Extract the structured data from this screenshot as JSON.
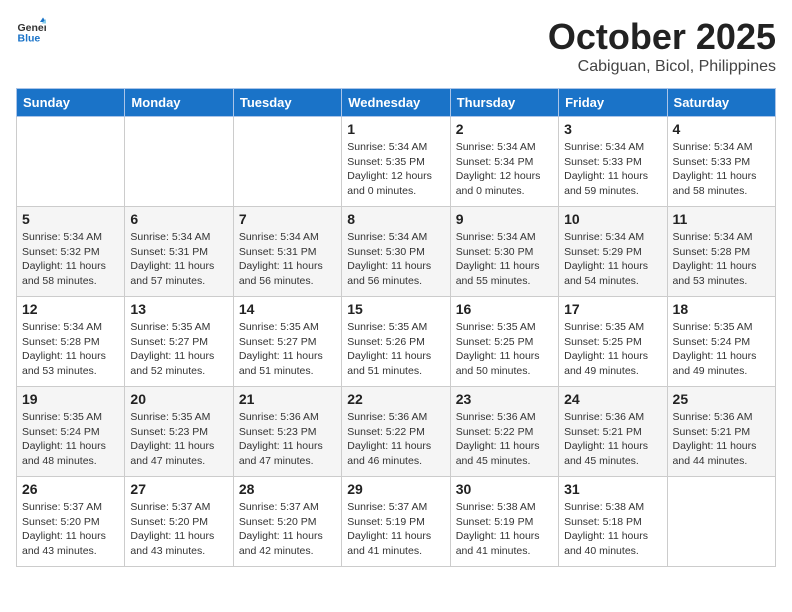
{
  "logo": {
    "line1": "General",
    "line2": "Blue"
  },
  "title": "October 2025",
  "location": "Cabiguan, Bicol, Philippines",
  "days_of_week": [
    "Sunday",
    "Monday",
    "Tuesday",
    "Wednesday",
    "Thursday",
    "Friday",
    "Saturday"
  ],
  "weeks": [
    [
      {
        "day": "",
        "info": ""
      },
      {
        "day": "",
        "info": ""
      },
      {
        "day": "",
        "info": ""
      },
      {
        "day": "1",
        "info": "Sunrise: 5:34 AM\nSunset: 5:35 PM\nDaylight: 12 hours\nand 0 minutes."
      },
      {
        "day": "2",
        "info": "Sunrise: 5:34 AM\nSunset: 5:34 PM\nDaylight: 12 hours\nand 0 minutes."
      },
      {
        "day": "3",
        "info": "Sunrise: 5:34 AM\nSunset: 5:33 PM\nDaylight: 11 hours\nand 59 minutes."
      },
      {
        "day": "4",
        "info": "Sunrise: 5:34 AM\nSunset: 5:33 PM\nDaylight: 11 hours\nand 58 minutes."
      }
    ],
    [
      {
        "day": "5",
        "info": "Sunrise: 5:34 AM\nSunset: 5:32 PM\nDaylight: 11 hours\nand 58 minutes."
      },
      {
        "day": "6",
        "info": "Sunrise: 5:34 AM\nSunset: 5:31 PM\nDaylight: 11 hours\nand 57 minutes."
      },
      {
        "day": "7",
        "info": "Sunrise: 5:34 AM\nSunset: 5:31 PM\nDaylight: 11 hours\nand 56 minutes."
      },
      {
        "day": "8",
        "info": "Sunrise: 5:34 AM\nSunset: 5:30 PM\nDaylight: 11 hours\nand 56 minutes."
      },
      {
        "day": "9",
        "info": "Sunrise: 5:34 AM\nSunset: 5:30 PM\nDaylight: 11 hours\nand 55 minutes."
      },
      {
        "day": "10",
        "info": "Sunrise: 5:34 AM\nSunset: 5:29 PM\nDaylight: 11 hours\nand 54 minutes."
      },
      {
        "day": "11",
        "info": "Sunrise: 5:34 AM\nSunset: 5:28 PM\nDaylight: 11 hours\nand 53 minutes."
      }
    ],
    [
      {
        "day": "12",
        "info": "Sunrise: 5:34 AM\nSunset: 5:28 PM\nDaylight: 11 hours\nand 53 minutes."
      },
      {
        "day": "13",
        "info": "Sunrise: 5:35 AM\nSunset: 5:27 PM\nDaylight: 11 hours\nand 52 minutes."
      },
      {
        "day": "14",
        "info": "Sunrise: 5:35 AM\nSunset: 5:27 PM\nDaylight: 11 hours\nand 51 minutes."
      },
      {
        "day": "15",
        "info": "Sunrise: 5:35 AM\nSunset: 5:26 PM\nDaylight: 11 hours\nand 51 minutes."
      },
      {
        "day": "16",
        "info": "Sunrise: 5:35 AM\nSunset: 5:25 PM\nDaylight: 11 hours\nand 50 minutes."
      },
      {
        "day": "17",
        "info": "Sunrise: 5:35 AM\nSunset: 5:25 PM\nDaylight: 11 hours\nand 49 minutes."
      },
      {
        "day": "18",
        "info": "Sunrise: 5:35 AM\nSunset: 5:24 PM\nDaylight: 11 hours\nand 49 minutes."
      }
    ],
    [
      {
        "day": "19",
        "info": "Sunrise: 5:35 AM\nSunset: 5:24 PM\nDaylight: 11 hours\nand 48 minutes."
      },
      {
        "day": "20",
        "info": "Sunrise: 5:35 AM\nSunset: 5:23 PM\nDaylight: 11 hours\nand 47 minutes."
      },
      {
        "day": "21",
        "info": "Sunrise: 5:36 AM\nSunset: 5:23 PM\nDaylight: 11 hours\nand 47 minutes."
      },
      {
        "day": "22",
        "info": "Sunrise: 5:36 AM\nSunset: 5:22 PM\nDaylight: 11 hours\nand 46 minutes."
      },
      {
        "day": "23",
        "info": "Sunrise: 5:36 AM\nSunset: 5:22 PM\nDaylight: 11 hours\nand 45 minutes."
      },
      {
        "day": "24",
        "info": "Sunrise: 5:36 AM\nSunset: 5:21 PM\nDaylight: 11 hours\nand 45 minutes."
      },
      {
        "day": "25",
        "info": "Sunrise: 5:36 AM\nSunset: 5:21 PM\nDaylight: 11 hours\nand 44 minutes."
      }
    ],
    [
      {
        "day": "26",
        "info": "Sunrise: 5:37 AM\nSunset: 5:20 PM\nDaylight: 11 hours\nand 43 minutes."
      },
      {
        "day": "27",
        "info": "Sunrise: 5:37 AM\nSunset: 5:20 PM\nDaylight: 11 hours\nand 43 minutes."
      },
      {
        "day": "28",
        "info": "Sunrise: 5:37 AM\nSunset: 5:20 PM\nDaylight: 11 hours\nand 42 minutes."
      },
      {
        "day": "29",
        "info": "Sunrise: 5:37 AM\nSunset: 5:19 PM\nDaylight: 11 hours\nand 41 minutes."
      },
      {
        "day": "30",
        "info": "Sunrise: 5:38 AM\nSunset: 5:19 PM\nDaylight: 11 hours\nand 41 minutes."
      },
      {
        "day": "31",
        "info": "Sunrise: 5:38 AM\nSunset: 5:18 PM\nDaylight: 11 hours\nand 40 minutes."
      },
      {
        "day": "",
        "info": ""
      }
    ]
  ]
}
